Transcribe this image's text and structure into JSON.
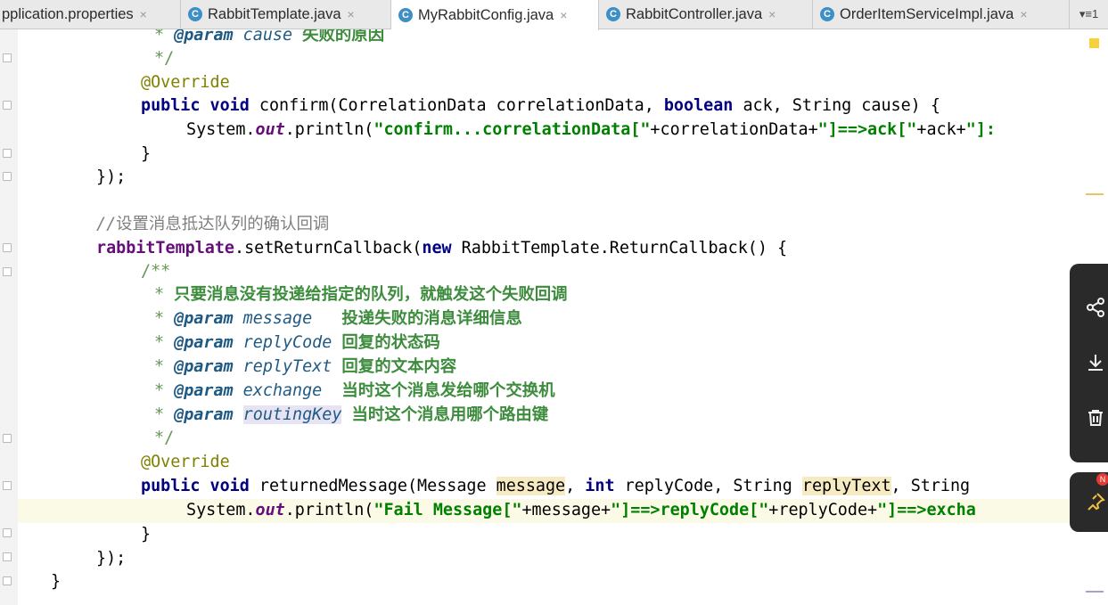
{
  "tabs": [
    {
      "label": "pplication.properties",
      "icon": "properties-file-icon",
      "active": false
    },
    {
      "label": "RabbitTemplate.java",
      "icon": "class-icon",
      "active": false
    },
    {
      "label": "MyRabbitConfig.java",
      "icon": "class-icon",
      "active": true
    },
    {
      "label": "RabbitController.java",
      "icon": "class-icon",
      "active": false
    },
    {
      "label": "OrderItemServiceImpl.java",
      "icon": "class-icon",
      "active": false
    }
  ],
  "tab_class_glyph": "C",
  "tab_close_glyph": "×",
  "tab_overflow": "▾≡1",
  "badge": "N",
  "code": {
    "l1_star": "* ",
    "l1_tag": "@param",
    "l1_param": "cause",
    "l1_cn": "失败的原因",
    "l2": "*/",
    "l3": "@Override",
    "l4_kw1": "public",
    "l4_kw2": "void",
    "l4_a": "confirm(CorrelationData correlationData, ",
    "l4_kw3": "boolean",
    "l4_b": " ack, String cause) {",
    "l5_a": "System.",
    "l5_out": "out",
    "l5_b": ".println(",
    "l5_s1": "\"confirm...correlationData[\"",
    "l5_c": "+correlationData+",
    "l5_s2": "\"]==>ack[\"",
    "l5_d": "+ack+",
    "l5_s3": "\"]:",
    "l6": "}",
    "l7": "});",
    "l8_slashes": "//",
    "l8_cn": "设置消息抵达队列的确认回调",
    "l9_field": "rabbitTemplate",
    "l9_a": ".setReturnCallback(",
    "l9_kw": "new",
    "l9_b": " RabbitTemplate.ReturnCallback() {",
    "l10": "/**",
    "l11_star": "* ",
    "l11_cn": "只要消息没有投递给指定的队列，就触发这个失败回调",
    "l12_tag": "@param",
    "l12_param": "message",
    "l12_cn": "投递失败的消息详细信息",
    "l13_tag": "@param",
    "l13_param": "replyCode",
    "l13_cn": "回复的状态码",
    "l14_tag": "@param",
    "l14_param": "replyText",
    "l14_cn": "回复的文本内容",
    "l15_tag": "@param",
    "l15_param": "exchange",
    "l15_cn": "当时这个消息发给哪个交换机",
    "l16_tag": "@param",
    "l16_param": "routingKey",
    "l16_cn": "当时这个消息用哪个路由键",
    "l17": "*/",
    "l18": "@Override",
    "l19_kw1": "public",
    "l19_kw2": "void",
    "l19_a": "returnedMessage(Message ",
    "l19_p1": "message",
    "l19_b": ", ",
    "l19_kw3": "int",
    "l19_c": " replyCode, String ",
    "l19_p2": "replyText",
    "l19_d": ", String",
    "l20_a": "System.",
    "l20_out": "out",
    "l20_b": ".println(",
    "l20_s1": "\"Fail Message[\"",
    "l20_c": "+message+",
    "l20_s2": "\"]==>replyCode[\"",
    "l20_d": "+replyCode+",
    "l20_s3": "\"]==>excha",
    "l21": "}",
    "l22": "});",
    "l23": "}"
  }
}
